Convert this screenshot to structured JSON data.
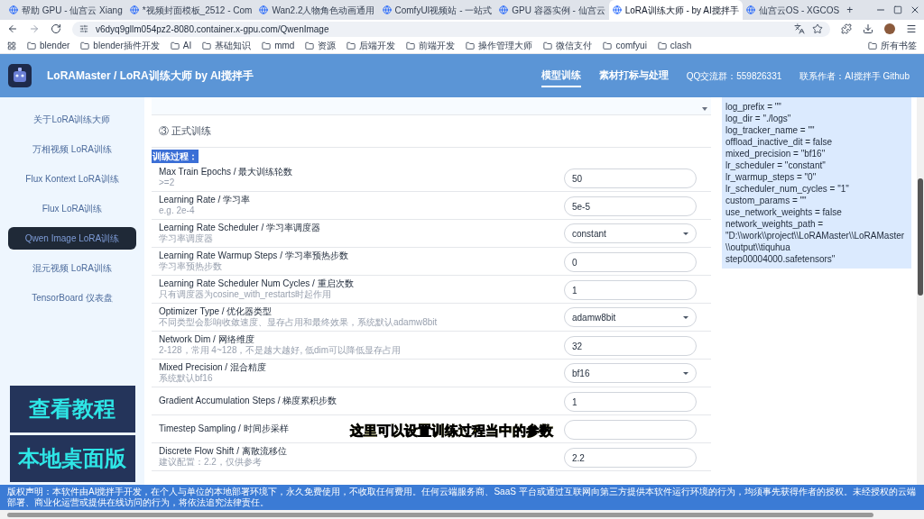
{
  "browser": {
    "tabs": [
      {
        "title": "帮助 GPU - 仙宫云 Xiang",
        "selected": false
      },
      {
        "title": "*视频封面模板_2512 - Com",
        "selected": false
      },
      {
        "title": "Wan2.2人物角色动画通用",
        "selected": false
      },
      {
        "title": "ComfyUI视频站 - 一站式",
        "selected": false
      },
      {
        "title": "GPU 容器实例 - 仙宫云",
        "selected": false
      },
      {
        "title": "LoRA训练大师 - by AI搅拌手",
        "selected": true
      },
      {
        "title": "仙宫云OS - XGCOS",
        "selected": false
      }
    ],
    "new_tab": "+",
    "url": "v6dyq9gllm054pz2-8080.container.x-gpu.com/QwenImage",
    "bookmarks": [
      "blender",
      "blender插件开发",
      "AI",
      "基础知识",
      "mmd",
      "资源",
      "后端开发",
      "前端开发",
      "操作管理大师",
      "微信支付",
      "comfyui",
      "clash"
    ],
    "all_bookmarks": "所有书签"
  },
  "header": {
    "title": "LoRAMaster / LoRA训练大师 by AI搅拌手",
    "nav": [
      {
        "label": "模型训练",
        "selected": true
      },
      {
        "label": "素材打标与处理",
        "selected": false
      }
    ],
    "qq": "QQ交流群：559826331",
    "contact": "联系作者：AI搅拌手 Github"
  },
  "sidebar": {
    "items": [
      {
        "label": "关于LoRA训练大师",
        "selected": false
      },
      {
        "label": "万相视频 LoRA训练",
        "selected": false
      },
      {
        "label": "Flux Kontext LoRA训练",
        "selected": false
      },
      {
        "label": "Flux LoRA训练",
        "selected": false
      },
      {
        "label": "Qwen Image LoRA训练",
        "selected": true
      },
      {
        "label": "混元视频 LoRA训练",
        "selected": false
      },
      {
        "label": "TensorBoard 仪表盘",
        "selected": false
      }
    ],
    "banners": [
      "查看教程",
      "本地桌面版"
    ]
  },
  "section": {
    "title": "③ 正式训练",
    "group": "训练过程：",
    "params": [
      {
        "label": "Max Train Epochs / 最大训练轮数",
        "hint": ">=2",
        "kind": "input",
        "value": "50"
      },
      {
        "label": "Learning Rate / 学习率",
        "hint": "e.g. 2e-4",
        "kind": "input",
        "value": "5e-5"
      },
      {
        "label": "Learning Rate Scheduler / 学习率调度器",
        "hint": "学习率调度器",
        "kind": "select",
        "value": "constant"
      },
      {
        "label": "Learning Rate Warmup Steps / 学习率预热步数",
        "hint": "学习率预热步数",
        "kind": "input",
        "value": "0"
      },
      {
        "label": "Learning Rate Scheduler Num Cycles / 重启次数",
        "hint": "只有调度器为cosine_with_restarts时起作用",
        "kind": "input",
        "value": "1"
      },
      {
        "label": "Optimizer Type / 优化器类型",
        "hint": "不同类型会影响收敛速度、显存占用和最终效果，系统默认adamw8bit",
        "kind": "select",
        "value": "adamw8bit"
      },
      {
        "label": "Network Dim / 网络维度",
        "hint": "2-128，常用 4~128，不是越大越好, 低dim可以降低显存占用",
        "kind": "input",
        "value": "32"
      },
      {
        "label": "Mixed Precision / 混合精度",
        "hint": "系统默认bf16",
        "kind": "select",
        "value": "bf16"
      },
      {
        "label": "Gradient Accumulation Steps / 梯度累积步数",
        "kind": "input",
        "value": "1"
      },
      {
        "label": "Timestep Sampling / 时间步采样",
        "kind": "input"
      },
      {
        "label": "Discrete Flow Shift / 离散流移位",
        "hint": "建议配置：2.2，仅供参考",
        "kind": "input",
        "value": "2.2"
      }
    ]
  },
  "config_lines": [
    "log_prefix = \"\"",
    "log_dir = \"./logs\"",
    "log_tracker_name = \"\"",
    "offload_inactive_dit = false",
    "mixed_precision = \"bf16\"",
    "lr_scheduler = \"constant\"",
    "lr_warmup_steps = \"0\"",
    "lr_scheduler_num_cycles = \"1\"",
    "custom_params = \"\"",
    "use_network_weights = false",
    "network_weights_path =",
    "\"D:\\\\work\\\\project\\\\LoRAMaster\\\\LoRAMaster\\\\output\\\\tiquhua",
    "step00004000.safetensors\""
  ],
  "footer": "版权声明：本软件由AI搅拌手开发，在个人与单位的本地部署环境下，永久免费使用，不收取任何费用。任何云端服务商、SaaS 平台或通过互联网向第三方提供本软件运行环境的行为，均须事先获得作者的授权。未经授权的云端部署、商业化运营或提供在线访问的行为，将依法追究法律责任。",
  "caption": "这里可以设置训练过程当中的参数"
}
